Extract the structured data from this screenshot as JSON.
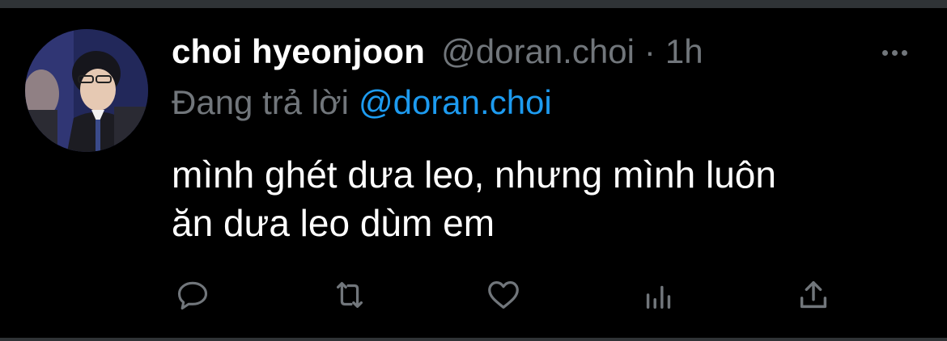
{
  "tweet": {
    "author_name": "choi hyeonjoon",
    "author_handle": "@doran.choi",
    "separator": "·",
    "time": "1h",
    "reply_prefix": "Đang trả lời",
    "reply_to": "@doran.choi",
    "text": "mình ghét dưa leo, nhưng mình luôn\năn dưa leo dùm em"
  },
  "actions": [
    {
      "name": "reply",
      "icon": "reply-icon"
    },
    {
      "name": "retweet",
      "icon": "retweet-icon"
    },
    {
      "name": "like",
      "icon": "heart-icon"
    },
    {
      "name": "analytics",
      "icon": "analytics-icon"
    },
    {
      "name": "share",
      "icon": "share-icon"
    }
  ],
  "colors": {
    "background": "#000000",
    "text_primary": "#ffffff",
    "text_secondary": "#71767b",
    "link": "#1d9bf0",
    "divider": "#2f3336"
  }
}
